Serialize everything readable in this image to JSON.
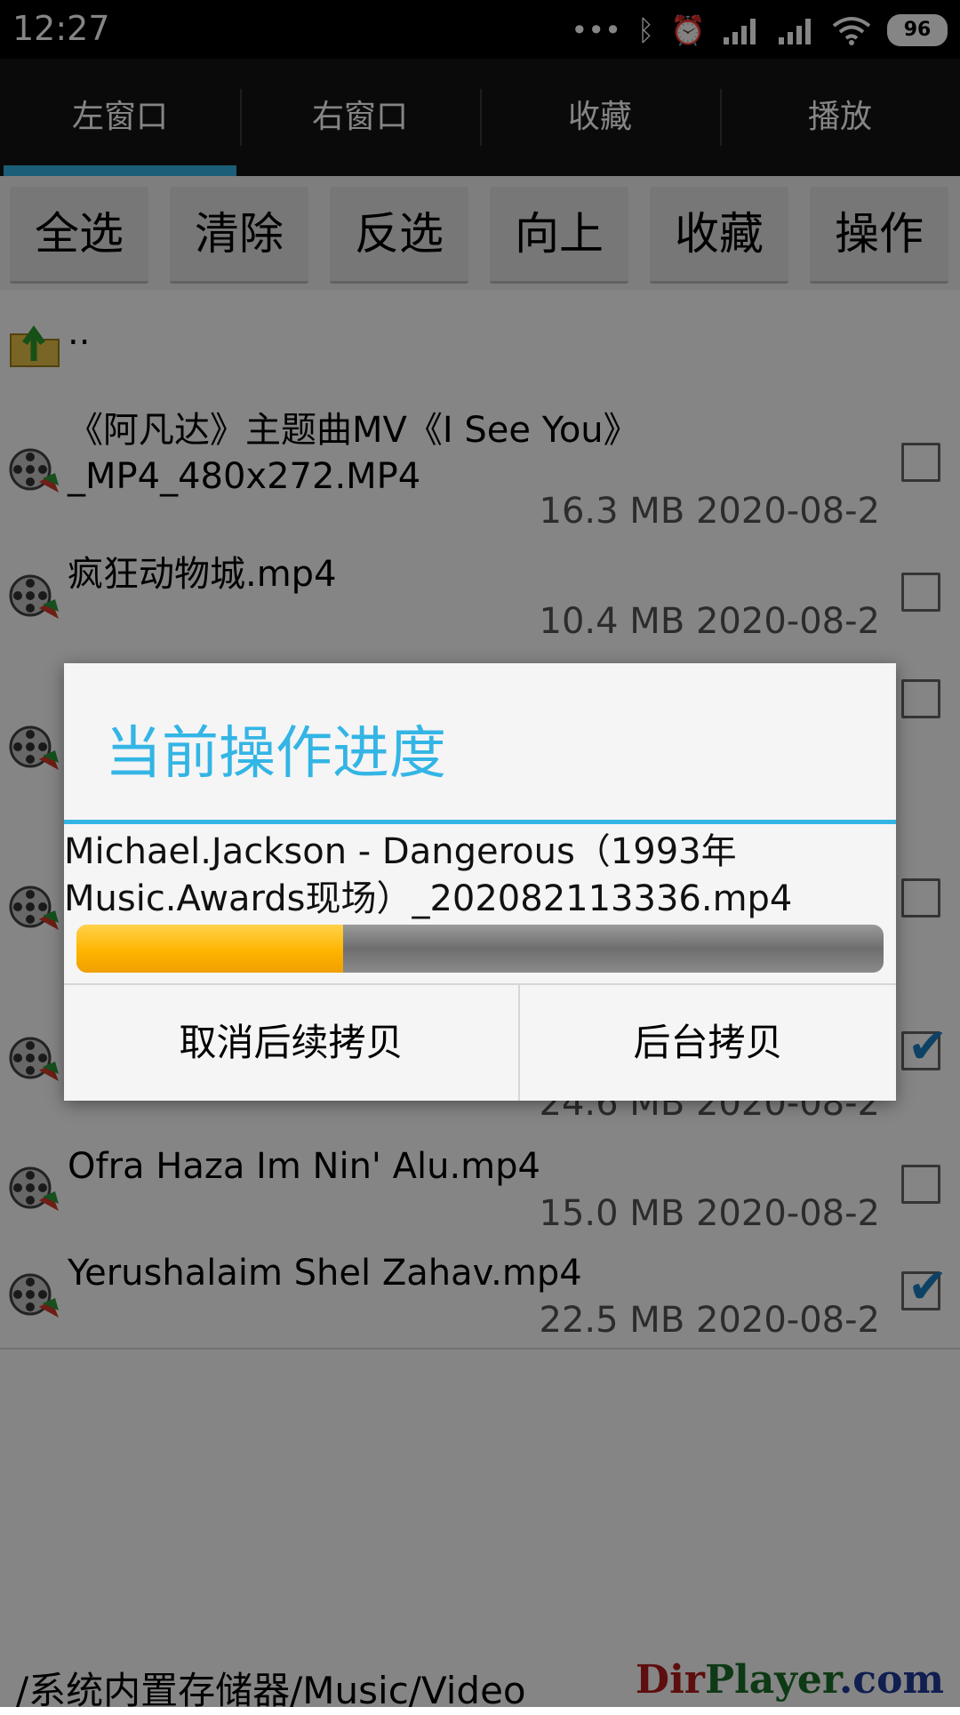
{
  "status_bar": {
    "time": "12:27",
    "battery": "96",
    "icons": [
      "more-dots-icon",
      "bluetooth-icon",
      "alarm-icon",
      "signal-icon",
      "signal-icon",
      "wifi-icon",
      "battery-icon"
    ]
  },
  "tabs": [
    {
      "label": "左窗口",
      "active": true
    },
    {
      "label": "右窗口",
      "active": false
    },
    {
      "label": "收藏",
      "active": false
    },
    {
      "label": "播放",
      "active": false
    }
  ],
  "toolbar": {
    "select_all": "全选",
    "clear": "清除",
    "invert": "反选",
    "up": "向上",
    "favorite": "收藏",
    "operate": "操作"
  },
  "files": {
    "parent": {
      "name": ".."
    },
    "items": [
      {
        "name": "《阿凡达》主题曲MV《I See You》_MP4_480x272.MP4",
        "size": "16.3 MB",
        "date": "2020-08-2",
        "checked": false
      },
      {
        "name": "疯狂动物城.mp4",
        "size": "10.4 MB",
        "date": "2020-08-2",
        "checked": false
      },
      {
        "checked": false
      },
      {
        "checked": false
      },
      {
        "size": "24.6 MB",
        "date": "2020-08-2",
        "checked": true
      },
      {
        "name": "Ofra Haza Im Nin' Alu.mp4",
        "size": "15.0 MB",
        "date": "2020-08-2",
        "checked": false
      },
      {
        "name": "Yerushalaim Shel Zahav.mp4",
        "size": "22.5 MB",
        "date": "2020-08-2",
        "checked": true
      }
    ]
  },
  "path": "/系统内置存储器/Music/Video",
  "brand": {
    "part1": "Dir",
    "part2": "Player",
    "part3": ".com",
    "colors": {
      "dir": "#b31b1b",
      "player": "#1c6e2a",
      "com": "#1f3a9a"
    }
  },
  "dialog": {
    "title": "当前操作进度",
    "filename": "Michael.Jackson - Dangerous（1993年Music.Awards现场）_202082113336.mp4",
    "progress": 0.33,
    "cancel_label": "取消后续拷贝",
    "background_label": "后台拷贝"
  },
  "colors": {
    "accent": "#33b5e5",
    "progress": "#ffb400"
  }
}
